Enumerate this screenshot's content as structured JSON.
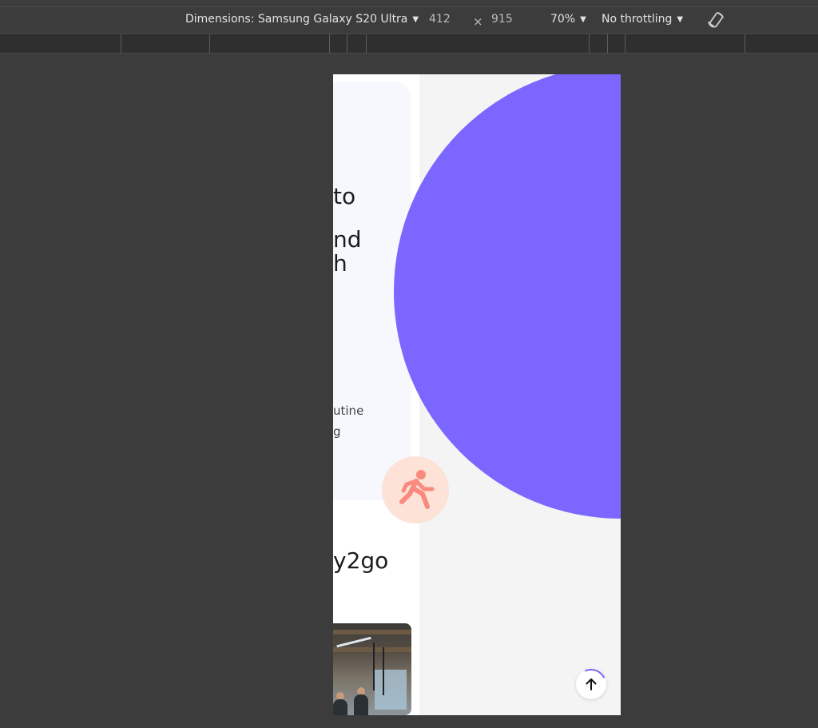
{
  "devtools": {
    "device_label": "Dimensions: Samsung Galaxy S20 Ultra",
    "width": "412",
    "times": "×",
    "height": "915",
    "zoom": "70%",
    "throttling": "No throttling"
  },
  "page": {
    "hero_title_lines": [
      "to",
      "nd",
      "h"
    ],
    "hero_subtitle_lines": [
      "utine",
      "g"
    ],
    "brand_text": "y2go"
  },
  "icons": {
    "runner": "running-person-icon",
    "scroll_top": "arrow-up-icon",
    "rotate": "rotate-device-icon"
  },
  "colors": {
    "accent_purple": "#7b66ff",
    "runner_bg": "#fde2d8",
    "runner_fg": "#f98b7e",
    "hero_card_bg": "#f6f8fd"
  }
}
